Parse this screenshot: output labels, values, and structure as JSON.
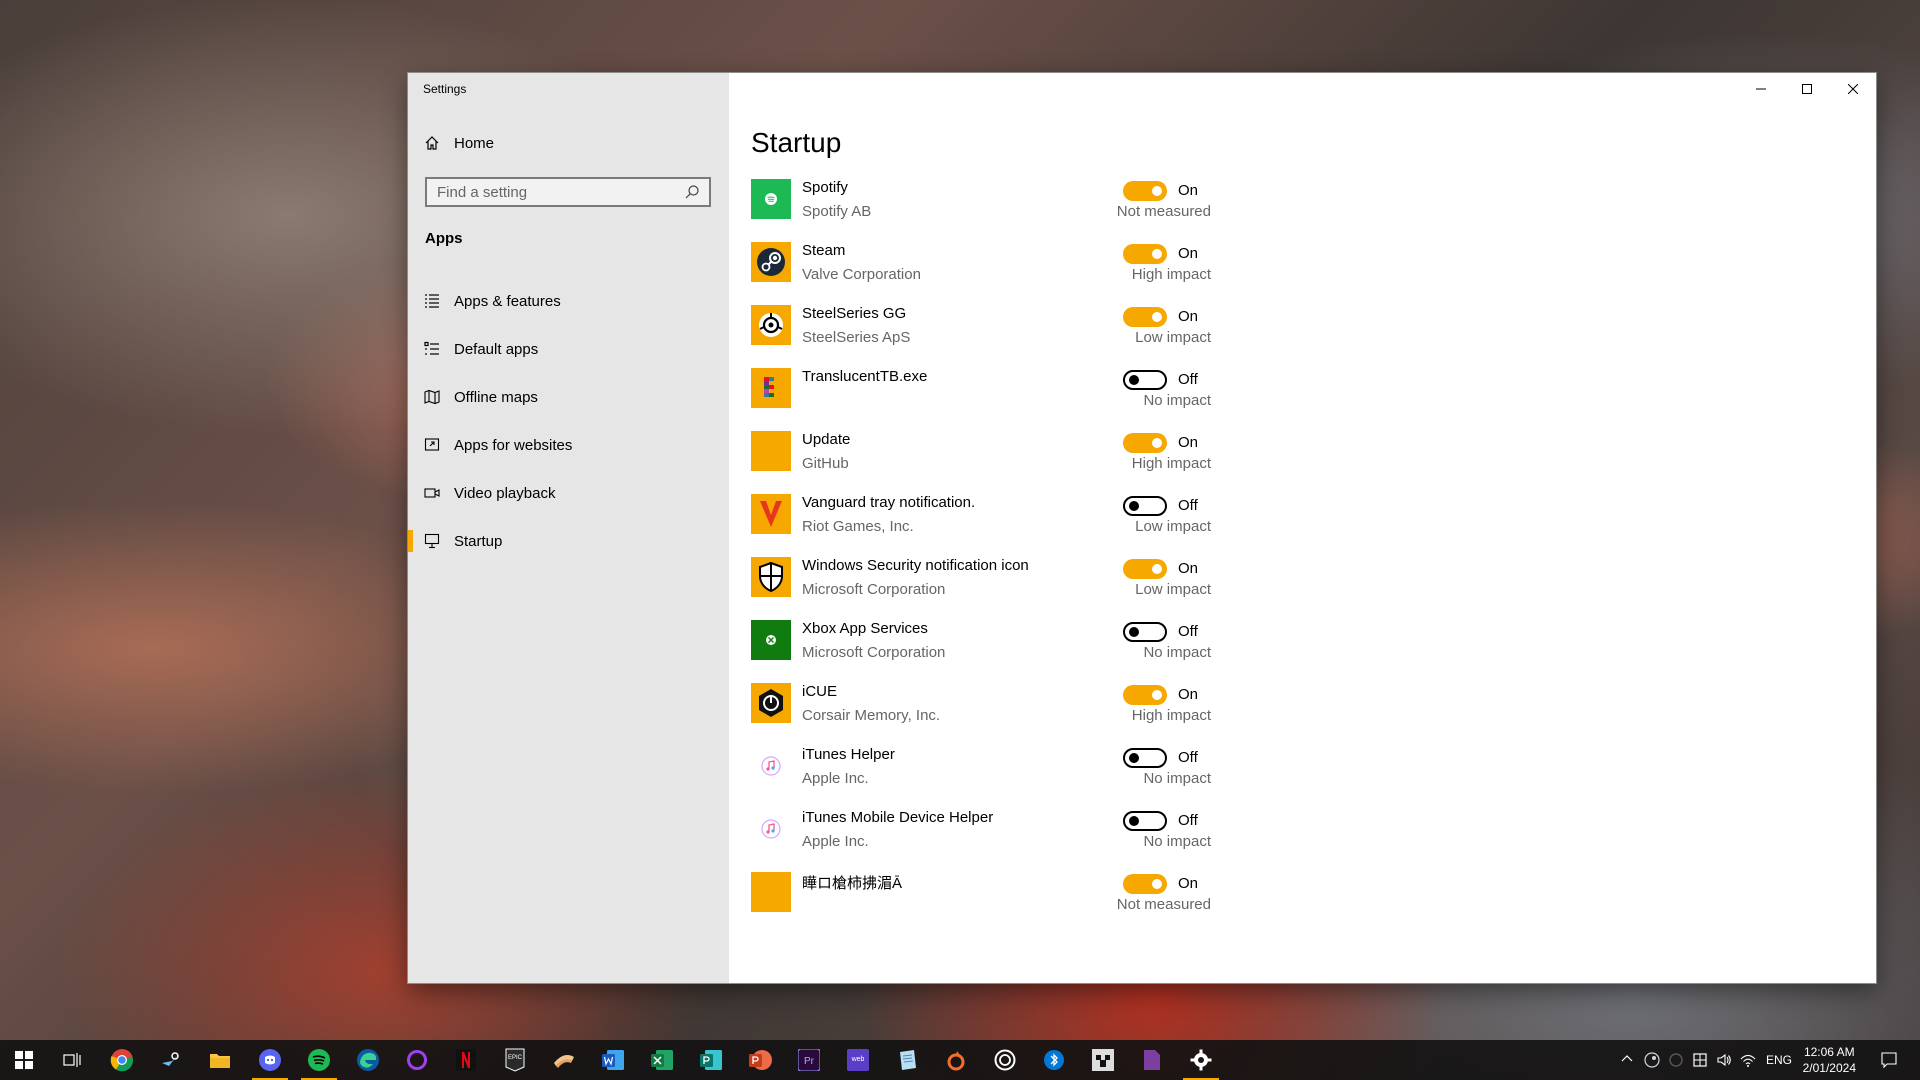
{
  "window": {
    "title": "Settings"
  },
  "sidebar": {
    "home_label": "Home",
    "search_placeholder": "Find a setting",
    "section": "Apps",
    "items": [
      {
        "label": "Apps & features",
        "icon": "list-icon"
      },
      {
        "label": "Default apps",
        "icon": "default-apps-icon"
      },
      {
        "label": "Offline maps",
        "icon": "map-icon"
      },
      {
        "label": "Apps for websites",
        "icon": "apps-websites-icon"
      },
      {
        "label": "Video playback",
        "icon": "video-icon"
      },
      {
        "label": "Startup",
        "icon": "startup-icon",
        "active": true
      }
    ]
  },
  "main": {
    "title": "Startup",
    "apps": [
      {
        "name": "Spotify",
        "publisher": "Spotify AB",
        "state": "On",
        "impact": "Not measured",
        "icon": "spotify-icon",
        "color": "#1db954"
      },
      {
        "name": "Steam",
        "publisher": "Valve Corporation",
        "state": "On",
        "impact": "High impact",
        "icon": "steam-icon",
        "color": "#f6a800"
      },
      {
        "name": "SteelSeries GG",
        "publisher": "SteelSeries ApS",
        "state": "On",
        "impact": "Low impact",
        "icon": "steelseries-icon",
        "color": "#f6a800"
      },
      {
        "name": "TranslucentTB.exe",
        "publisher": "",
        "state": "Off",
        "impact": "No impact",
        "icon": "translucenttb-icon",
        "color": "#f6a800"
      },
      {
        "name": "Update",
        "publisher": "GitHub",
        "state": "On",
        "impact": "High impact",
        "icon": "update-icon",
        "color": "#f6a800"
      },
      {
        "name": "Vanguard tray notification.",
        "publisher": "Riot Games, Inc.",
        "state": "Off",
        "impact": "Low impact",
        "icon": "vanguard-icon",
        "color": "#f6a800"
      },
      {
        "name": "Windows Security notification icon",
        "publisher": "Microsoft Corporation",
        "state": "On",
        "impact": "Low impact",
        "icon": "shield-icon",
        "color": "#f6a800"
      },
      {
        "name": "Xbox App Services",
        "publisher": "Microsoft Corporation",
        "state": "Off",
        "impact": "No impact",
        "icon": "xbox-icon",
        "color": "#107c10"
      },
      {
        "name": "iCUE",
        "publisher": "Corsair Memory, Inc.",
        "state": "On",
        "impact": "High impact",
        "icon": "icue-icon",
        "color": "#f6a800"
      },
      {
        "name": "iTunes Helper",
        "publisher": "Apple Inc.",
        "state": "Off",
        "impact": "No impact",
        "icon": "itunes-icon",
        "color": "#ffffff"
      },
      {
        "name": "iTunes Mobile Device Helper",
        "publisher": "Apple Inc.",
        "state": "Off",
        "impact": "No impact",
        "icon": "itunes-icon",
        "color": "#ffffff"
      },
      {
        "name": "瞱ロ槍柿拂湄Ā",
        "publisher": "",
        "state": "On",
        "impact": "Not measured",
        "icon": "blank-app-icon",
        "color": "#f6a800"
      }
    ]
  },
  "taskbar": {
    "apps": [
      "start-icon",
      "task-view-icon",
      "chrome-icon",
      "steam-icon",
      "file-explorer-icon",
      "discord-icon",
      "spotify-icon",
      "edge-icon",
      "cortana-icon",
      "netflix-icon",
      "epic-games-icon",
      "sandwich-icon",
      "word-icon",
      "excel-icon",
      "publisher-icon",
      "powerpoint-icon",
      "premiere-icon",
      "webex-icon",
      "notepad-icon",
      "origin-icon",
      "ubisoft-icon",
      "bluetooth-icon",
      "minecraft-icon",
      "file-icon",
      "settings-icon"
    ],
    "tray": {
      "language": "ENG",
      "time": "12:06 AM",
      "date": "2/01/2024"
    }
  },
  "colors": {
    "accent": "#f6a800",
    "sidebar_bg": "#e6e6e6"
  }
}
